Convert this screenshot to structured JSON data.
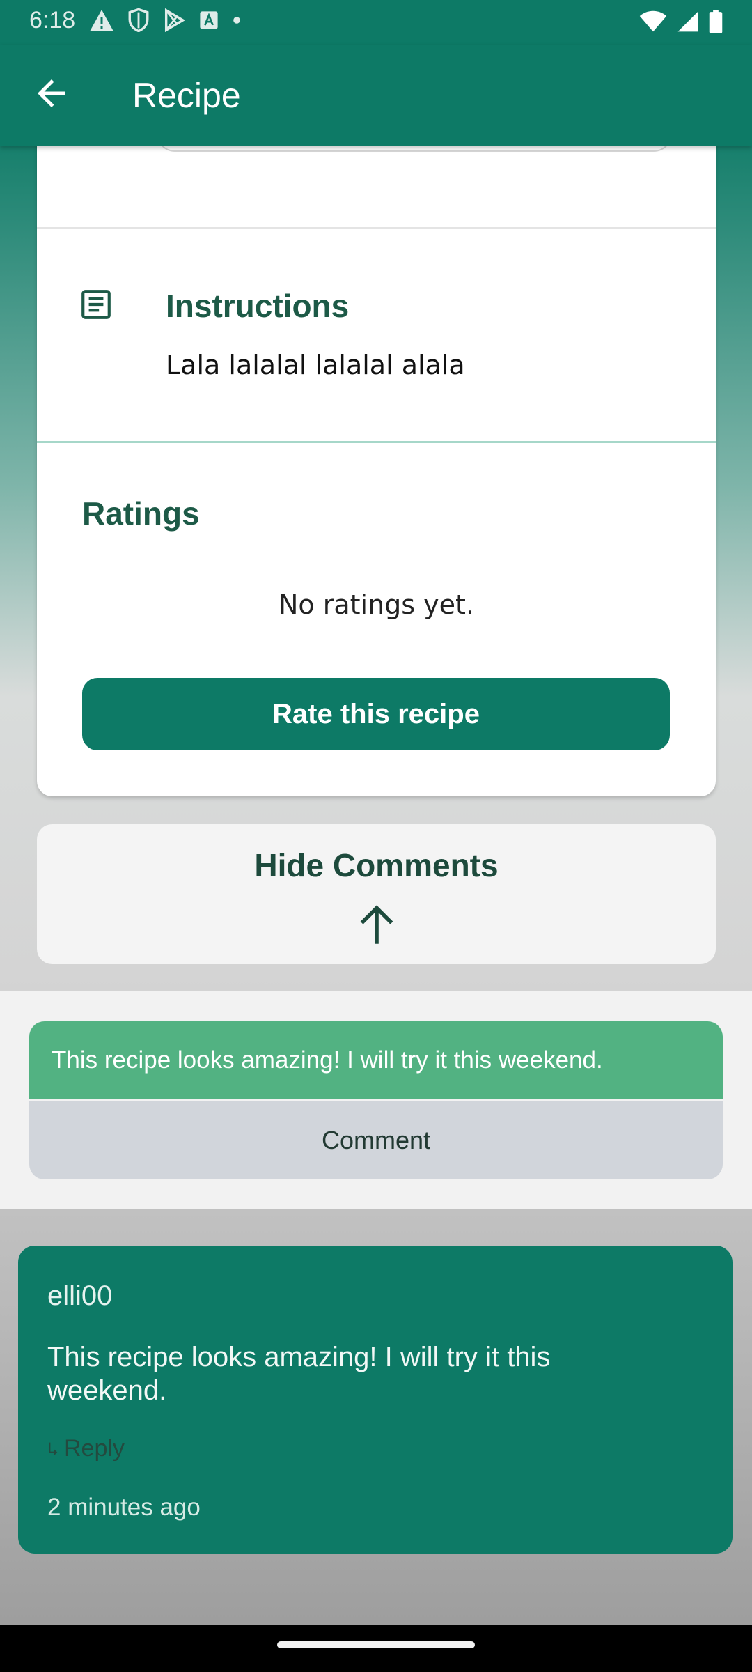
{
  "status_bar": {
    "time": "6:18",
    "icons_left": [
      "warning-icon",
      "shield-icon",
      "play-store-icon",
      "font-icon",
      "dot-icon"
    ],
    "icons_right": [
      "wifi-icon",
      "signal-icon",
      "battery-icon"
    ]
  },
  "app_bar": {
    "title": "Recipe"
  },
  "instructions": {
    "title": "Instructions",
    "text": "Lala lalalal lalalal alala"
  },
  "ratings": {
    "title": "Ratings",
    "empty_text": "No ratings yet.",
    "rate_button": "Rate this recipe"
  },
  "comments_toggle": {
    "label": "Hide Comments"
  },
  "comment_form": {
    "input_value": "This recipe looks amazing! I will try it this weekend.",
    "submit_label": "Comment"
  },
  "comments": [
    {
      "user": "elli00",
      "text": "This recipe looks amazing! I will try it this weekend.",
      "reply_label": "Reply",
      "time": "2 minutes ago"
    }
  ],
  "colors": {
    "primary": "#0d7a66",
    "input_green": "#52b282",
    "heading_green": "#1d5a47"
  }
}
